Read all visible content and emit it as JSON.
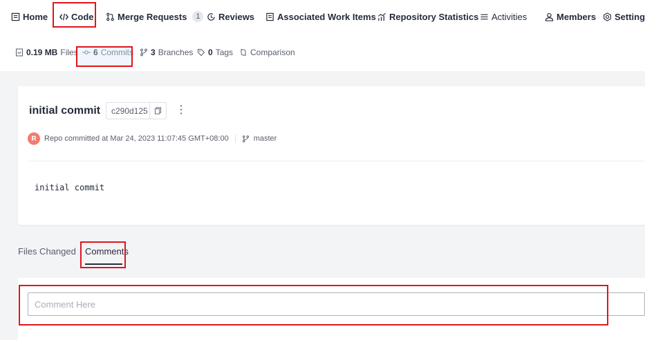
{
  "nav": {
    "items": [
      {
        "label": "Home",
        "icon": "home-icon"
      },
      {
        "label": "Code",
        "icon": "code-icon"
      },
      {
        "label": "Merge Requests",
        "icon": "merge-icon",
        "badge": "1"
      },
      {
        "label": "Reviews",
        "icon": "reviews-icon"
      },
      {
        "label": "Associated Work Items",
        "icon": "work-items-icon"
      },
      {
        "label": "Repository Statistics",
        "icon": "statistics-icon"
      },
      {
        "label": "Activities",
        "icon": "activities-icon"
      },
      {
        "label": "Members",
        "icon": "members-icon"
      },
      {
        "label": "Settings",
        "icon": "settings-icon"
      }
    ]
  },
  "subnav": {
    "files": {
      "count": "0.19 MB",
      "label": "Files"
    },
    "commits": {
      "count": "6",
      "label": "Commits"
    },
    "branches": {
      "count": "3",
      "label": "Branches"
    },
    "tags": {
      "count": "0",
      "label": "Tags"
    },
    "comparison": {
      "label": "Comparison"
    }
  },
  "commit": {
    "title": "initial commit",
    "hash": "c290d125",
    "author_initial": "R",
    "meta": "Repo committed at Mar 24, 2023 11:07:45 GMT+08:00",
    "branch": "master",
    "message": "initial commit"
  },
  "tabs": {
    "files_changed": "Files Changed",
    "comments": "Comments"
  },
  "comment": {
    "placeholder": "Comment Here"
  },
  "colors": {
    "highlight": "#e1131c",
    "avatar": "#f47b6e"
  }
}
